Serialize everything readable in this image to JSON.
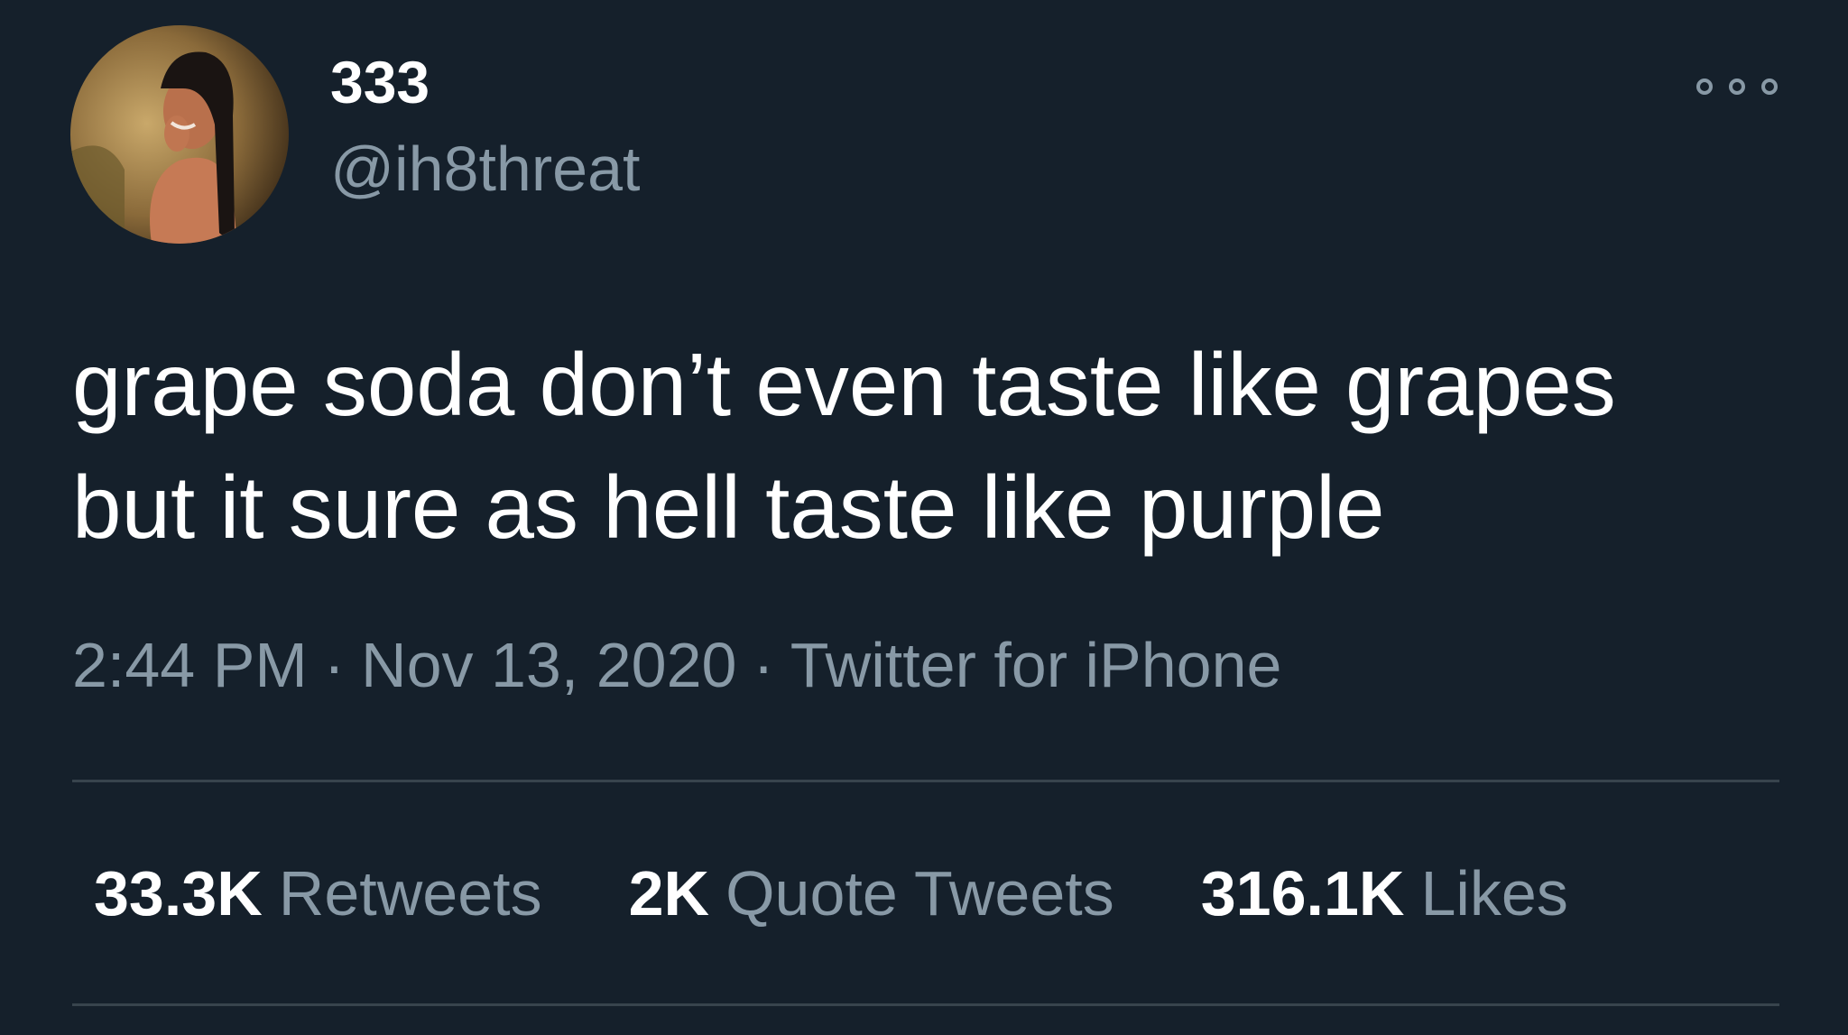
{
  "author": {
    "display_name": "333",
    "handle": "@ih8threat"
  },
  "tweet": {
    "text": "grape soda don’t even taste like grapes\nbut it sure as hell taste like purple",
    "time": "2:44 PM",
    "date": "Nov 13, 2020",
    "source": "Twitter for iPhone",
    "separator": "·"
  },
  "stats": {
    "retweets_count": "33.3K",
    "retweets_label": "Retweets",
    "quotes_count": "2K",
    "quotes_label": "Quote Tweets",
    "likes_count": "316.1K",
    "likes_label": "Likes"
  },
  "icons": {
    "more": "more-options-icon",
    "avatar": "avatar-photo"
  },
  "colors": {
    "background": "#15202b",
    "primary_text": "#ffffff",
    "secondary_text": "#8899a6",
    "divider": "#38444d"
  }
}
